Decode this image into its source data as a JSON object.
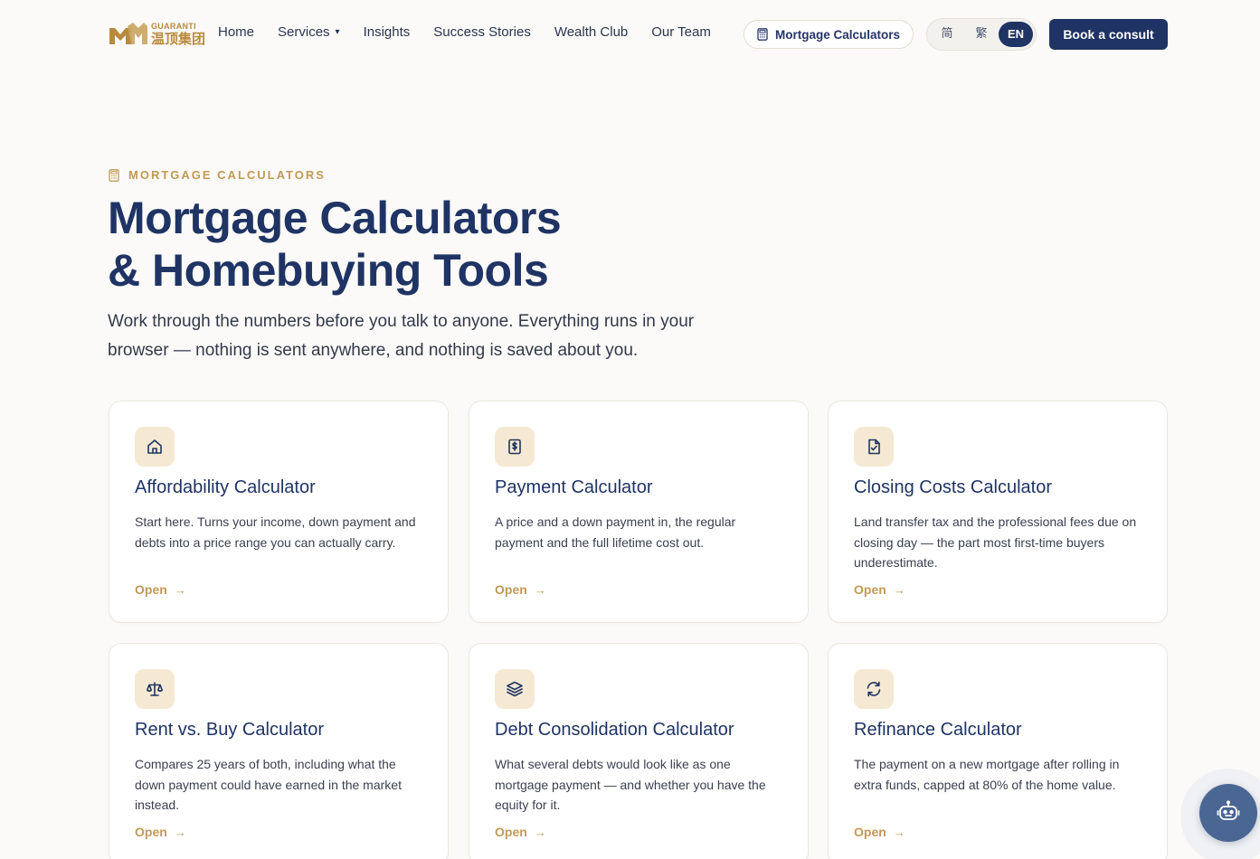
{
  "header": {
    "logo": {
      "brand_en": "GUARANTI",
      "brand_cn": "温顶集团"
    },
    "nav": [
      {
        "label": "Home",
        "has_dropdown": false
      },
      {
        "label": "Services",
        "has_dropdown": true
      },
      {
        "label": "Insights",
        "has_dropdown": false
      },
      {
        "label": "Success Stories",
        "has_dropdown": false
      },
      {
        "label": "Wealth Club",
        "has_dropdown": false
      },
      {
        "label": "Our Team",
        "has_dropdown": false
      }
    ],
    "calculators_pill": {
      "label": "Mortgage Calculators",
      "icon": "calculator-icon"
    },
    "languages": [
      {
        "label": "简",
        "active": false
      },
      {
        "label": "繁",
        "active": false
      },
      {
        "label": "EN",
        "active": true
      }
    ],
    "cta_label": "Book a consult"
  },
  "hero": {
    "eyebrow": "MORTGAGE CALCULATORS",
    "title_line1": "Mortgage Calculators",
    "title_line2": "& Homebuying Tools",
    "subtitle": "Work through the numbers before you talk to anyone. Everything runs in your browser — nothing is sent anywhere, and nothing is saved about you."
  },
  "cards": [
    {
      "icon": "home-icon",
      "title": "Affordability Calculator",
      "description": "Start here. Turns your income, down payment and debts into a price range you can actually carry.",
      "link": "Open"
    },
    {
      "icon": "dollar-receipt-icon",
      "title": "Payment Calculator",
      "description": "A price and a down payment in, the regular payment and the full lifetime cost out.",
      "link": "Open"
    },
    {
      "icon": "file-check-icon",
      "title": "Closing Costs Calculator",
      "description": "Land transfer tax and the professional fees due on closing day — the part most first-time buyers underestimate.",
      "link": "Open"
    },
    {
      "icon": "scale-icon",
      "title": "Rent vs. Buy Calculator",
      "description": "Compares 25 years of both, including what the down payment could have earned in the market instead.",
      "link": "Open"
    },
    {
      "icon": "layers-icon",
      "title": "Debt Consolidation Calculator",
      "description": "What several debts would look like as one mortgage payment — and whether you have the equity for it.",
      "link": "Open"
    },
    {
      "icon": "refresh-icon",
      "title": "Refinance Calculator",
      "description": "The payment on a new mortgage after rolling in extra funds, capped at 80% of the home value.",
      "link": "Open"
    }
  ],
  "colors": {
    "navy": "#1f3464",
    "gold": "#c09a55",
    "icon_bg": "#f5e9d3",
    "page_bg": "#fbfaf8"
  }
}
